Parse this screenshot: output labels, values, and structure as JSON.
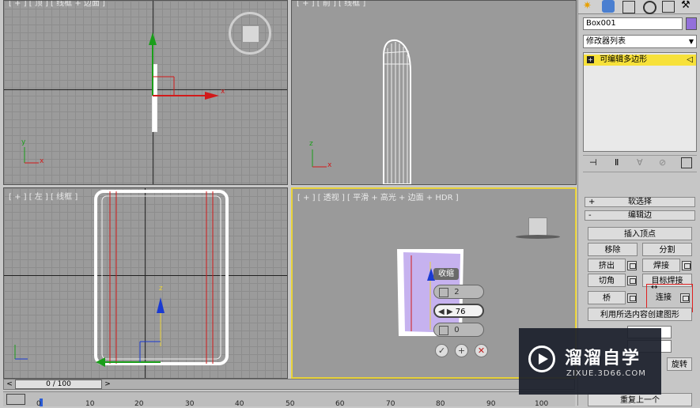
{
  "viewports": {
    "top": {
      "label": "[ + ] [ 顶 ] [ 线框 + 边面 ]"
    },
    "front": {
      "label": "[ + ] [ 前 ] [ 线框 ]"
    },
    "left": {
      "label": "[ + ] [ 左 ] [ 线框 ]"
    },
    "perspective": {
      "label": "[ + ] [ 透视 ] [ 平滑 + 高光 + 边面 + HDR ]"
    }
  },
  "axes": {
    "x": "x",
    "y": "y",
    "z": "z"
  },
  "caddy": {
    "title": "收缩",
    "segments": "2",
    "slide": "76",
    "pinch": "0"
  },
  "command_panel": {
    "object_name": "Box001",
    "object_color": "#9370DB",
    "modifier_list": "修改器列表",
    "stack_item": "可编辑多边形",
    "rollouts": {
      "soft_selection": "软选择",
      "edit_edges": "编辑边"
    },
    "buttons": {
      "insert_vertex": "插入顶点",
      "remove": "移除",
      "split": "分割",
      "extrude": "挤出",
      "weld": "焊接",
      "chamfer": "切角",
      "target_weld": "目标焊接",
      "bridge": "桥",
      "connect": "连接",
      "create_shape": "利用所选内容创建图形",
      "turn": "旋转",
      "repeat_last": "重复上一个"
    }
  },
  "timeline": {
    "frame_display": "0 / 100",
    "prev_label": "<",
    "next_label": ">",
    "ticks": [
      "0",
      "10",
      "20",
      "30",
      "40",
      "50",
      "60",
      "70",
      "80",
      "90",
      "100"
    ]
  },
  "watermark": {
    "brand": "溜溜自学",
    "url": "ZIXUE.3D66.COM"
  }
}
